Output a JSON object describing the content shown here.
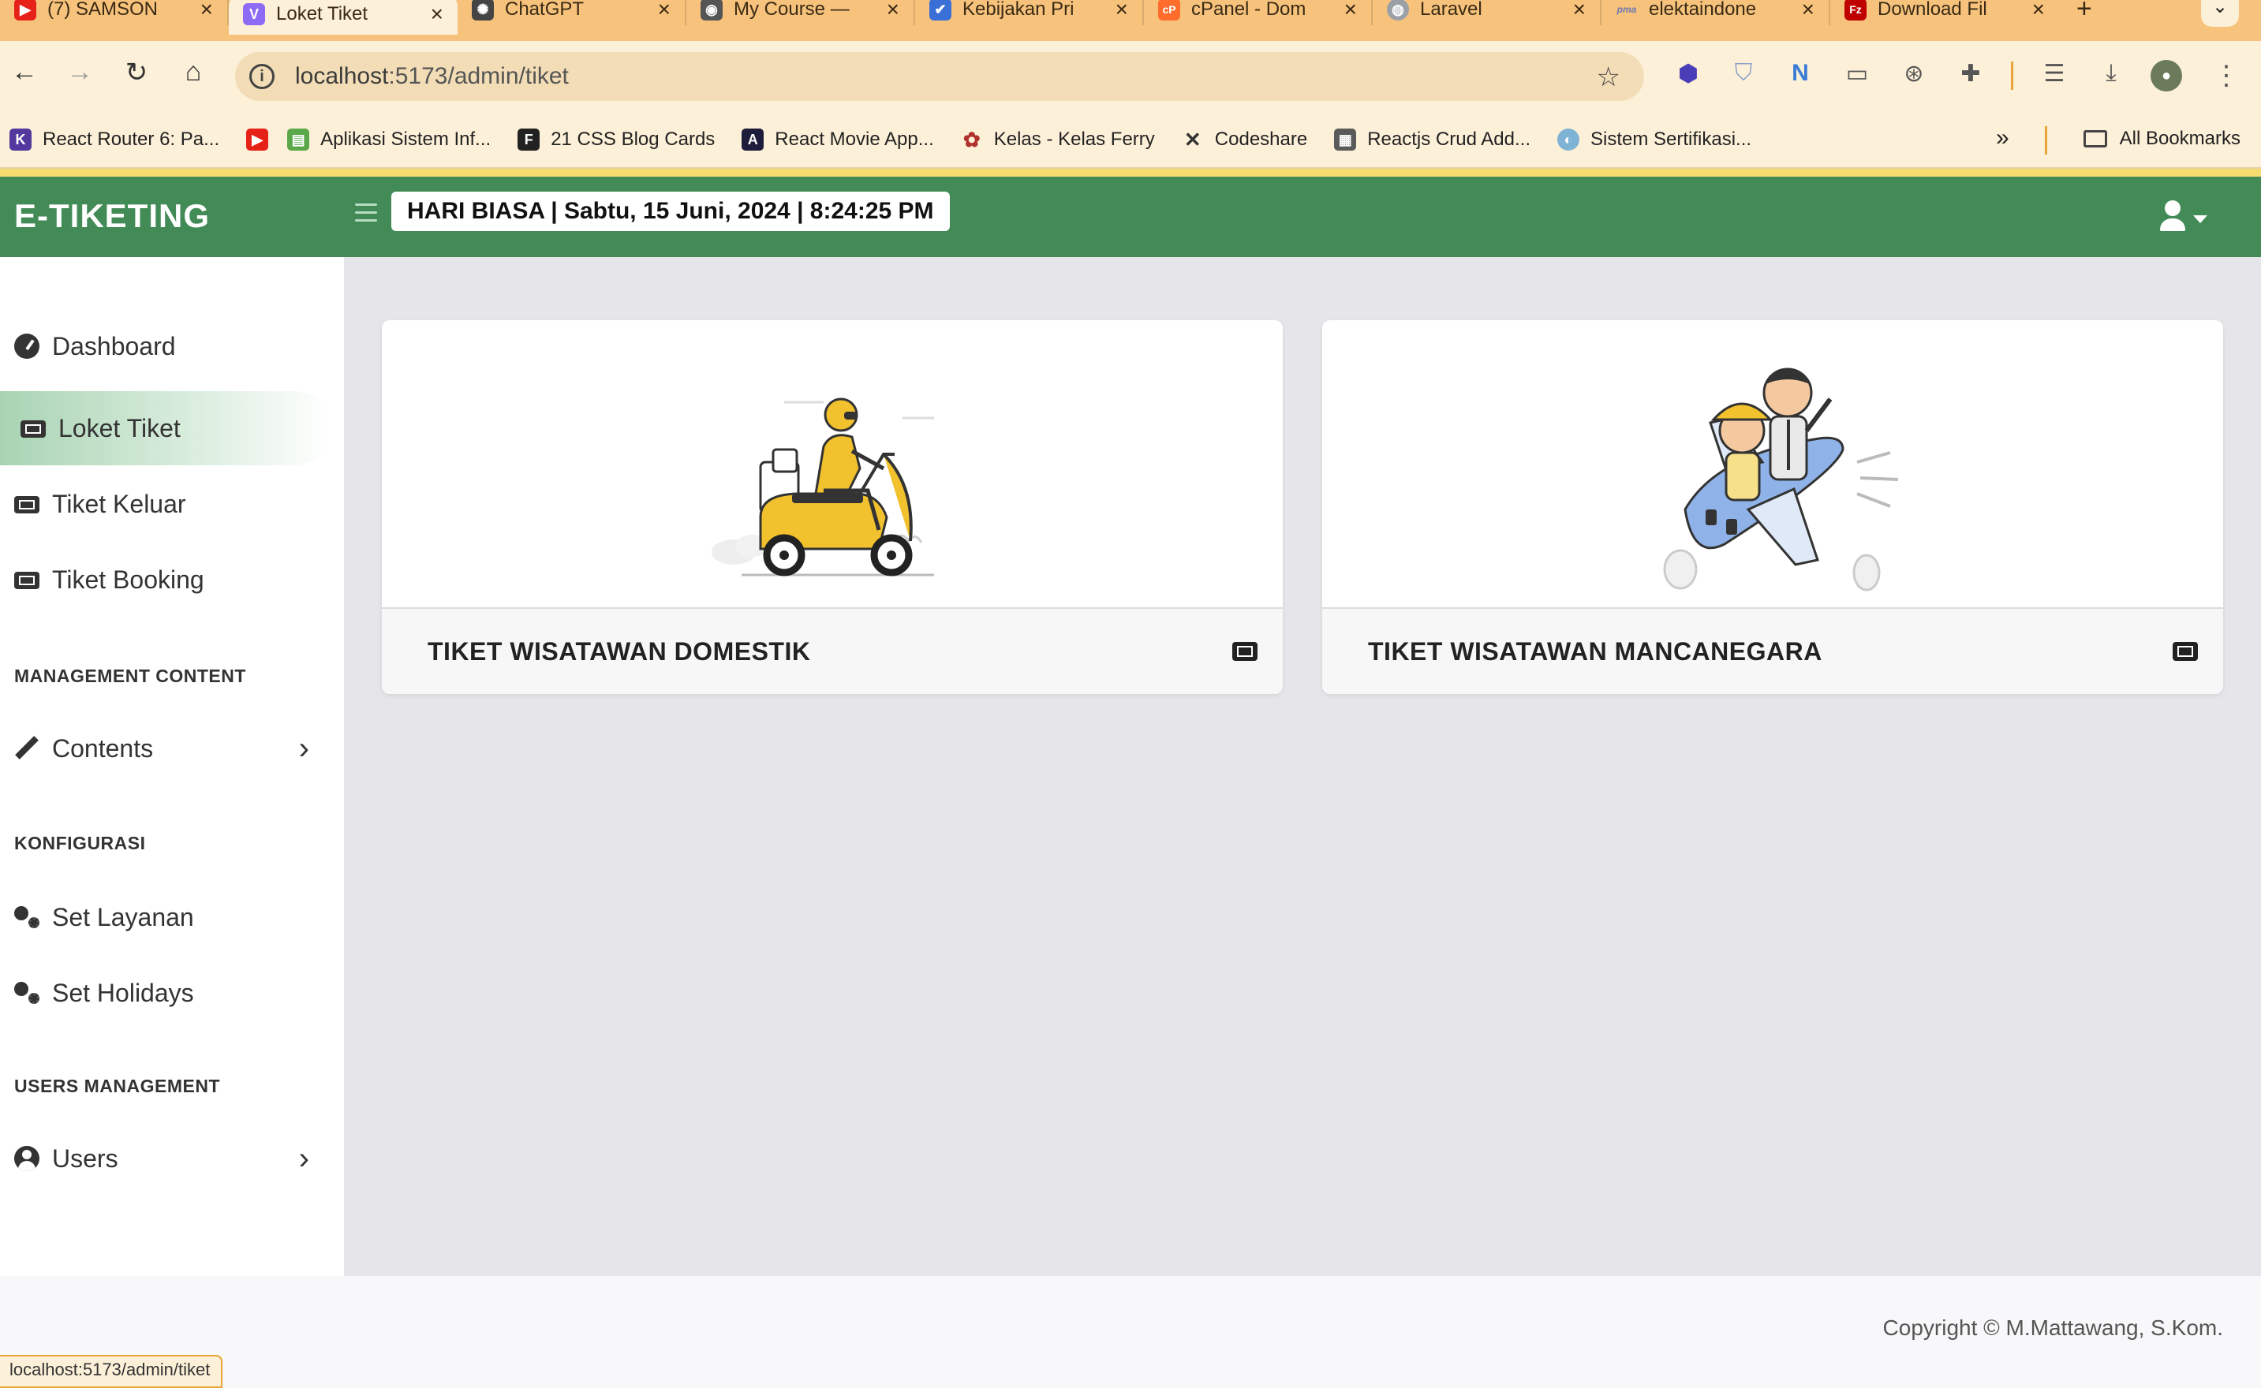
{
  "browser": {
    "tabs": [
      {
        "title": "(7) SAMSON",
        "favicon": "youtube-favicon",
        "color": "#e62117",
        "glyph": "▶",
        "active": false
      },
      {
        "title": "Loket Tiket",
        "favicon": "vite-favicon",
        "color": "#8e6bf5",
        "glyph": "V",
        "active": true
      },
      {
        "title": "ChatGPT",
        "favicon": "chatgpt-favicon",
        "color": "#444444",
        "glyph": "✺",
        "active": false
      },
      {
        "title": "My Course —",
        "favicon": "course-favicon",
        "color": "#555555",
        "glyph": "◉",
        "active": false
      },
      {
        "title": "Kebijakan Pri",
        "favicon": "kebijakan-favicon",
        "color": "#3b6fd8",
        "glyph": "✔",
        "active": false
      },
      {
        "title": "cPanel - Dom",
        "favicon": "cpanel-favicon",
        "color": "#ff6c2c",
        "glyph": "cP",
        "active": false
      },
      {
        "title": "Laravel",
        "favicon": "globe-favicon",
        "color": "#9aa0a6",
        "glyph": "◍",
        "active": false
      },
      {
        "title": "elektaindone",
        "favicon": "pma-favicon",
        "color": "#6c78af",
        "glyph": "pma",
        "active": false
      },
      {
        "title": "Download Fil",
        "favicon": "filezilla-favicon",
        "color": "#bf0000",
        "glyph": "Fz",
        "active": false
      }
    ],
    "url_host": "localhost",
    "url_path": ":5173/admin/tiket",
    "bookmarks": [
      {
        "label": "React Router 6: Pa...",
        "icon": "kinsta-icon",
        "color": "#53389e",
        "glyph": "K"
      },
      {
        "label": "",
        "icon": "youtube-icon",
        "color": "#e62117",
        "glyph": "▶"
      },
      {
        "label": "Aplikasi Sistem Inf...",
        "icon": "aplikasi-icon",
        "color": "#5ba84a",
        "glyph": "▤"
      },
      {
        "label": "21 CSS Blog Cards",
        "icon": "f-icon",
        "color": "#222222",
        "glyph": "F"
      },
      {
        "label": "React Movie App...",
        "icon": "react-movie-icon",
        "color": "#1d1d3b",
        "glyph": "A"
      },
      {
        "label": "Kelas - Kelas Ferry",
        "icon": "kelas-icon",
        "color": "#b0322c",
        "glyph": "✿"
      },
      {
        "label": "Codeshare",
        "icon": "codeshare-icon",
        "color": "#333333",
        "glyph": "✕"
      },
      {
        "label": "Reactjs Crud Add...",
        "icon": "reactjs-crud-icon",
        "color": "#5a5a5a",
        "glyph": "▦"
      },
      {
        "label": "Sistem Sertifikasi...",
        "icon": "sertifikasi-icon",
        "color": "#7fb3d5",
        "glyph": "◐"
      }
    ],
    "all_bookmarks_label": "All Bookmarks",
    "status_url": "localhost:5173/admin/tiket"
  },
  "app": {
    "brand": "E-TIKETING",
    "date_display": "HARI BIASA | Sabtu, 15 Juni, 2024 | 8:24:25 PM"
  },
  "sidebar": {
    "items": [
      {
        "label": "Dashboard",
        "icon": "dashboard-icon"
      },
      {
        "label": "Loket Tiket",
        "icon": "ticket-icon",
        "active": true
      },
      {
        "label": "Tiket Keluar",
        "icon": "ticket-icon"
      },
      {
        "label": "Tiket Booking",
        "icon": "ticket-icon"
      }
    ],
    "section_content": "MANAGEMENT CONTENT",
    "contents_label": "Contents",
    "section_config": "KONFIGURASI",
    "set_layanan_label": "Set Layanan",
    "set_holidays_label": "Set Holidays",
    "section_users": "USERS MANAGEMENT",
    "users_label": "Users"
  },
  "cards": [
    {
      "title": "TIKET WISATAWAN DOMESTIK",
      "illustration": "scooter-rider-illustration"
    },
    {
      "title": "TIKET WISATAWAN MANCANEGARA",
      "illustration": "airplane-travelers-illustration"
    }
  ],
  "footer": {
    "copyright": "Copyright © M.Mattawang, S.Kom."
  },
  "colors": {
    "header_green": "#428b57",
    "tabbar_orange": "#f6c27c",
    "main_bg": "#e6e6ea",
    "active_nav": "#a8d3b3",
    "scooter_yellow": "#f2c12e"
  }
}
